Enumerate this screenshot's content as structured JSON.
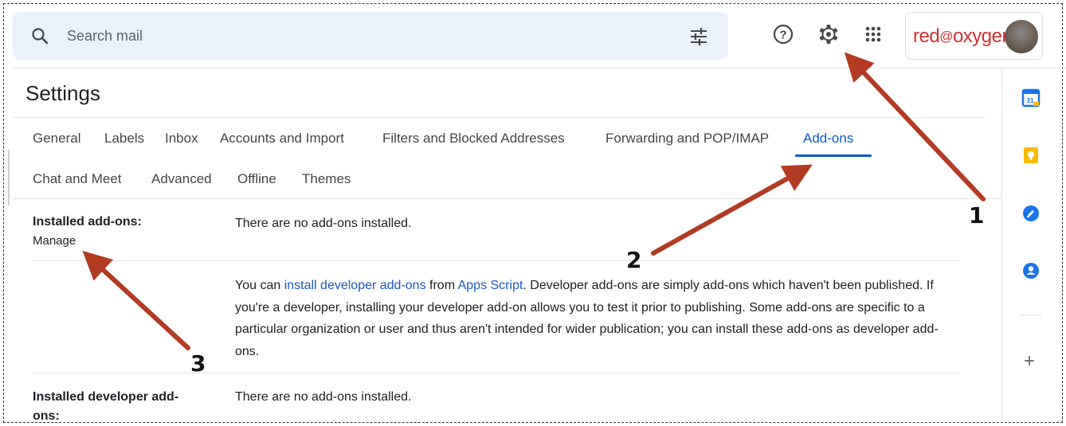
{
  "search": {
    "placeholder": "Search mail"
  },
  "header": {
    "brand_part1": "red",
    "brand_part2": "oxygen",
    "colors": {
      "brand": "#d32f2f",
      "accent": "#0b57d0",
      "link": "#1a57c6",
      "arrow": "#b23b22"
    }
  },
  "page": {
    "title": "Settings"
  },
  "tabs": [
    {
      "label": "General"
    },
    {
      "label": "Labels"
    },
    {
      "label": "Inbox"
    },
    {
      "label": "Accounts and Import"
    },
    {
      "label": "Filters and Blocked Addresses"
    },
    {
      "label": "Forwarding and POP/IMAP"
    },
    {
      "label": "Add-ons",
      "active": true
    },
    {
      "label": "Chat and Meet"
    },
    {
      "label": "Advanced"
    },
    {
      "label": "Offline"
    },
    {
      "label": "Themes"
    }
  ],
  "addons": {
    "installed_label": "Installed add-ons:",
    "manage_link": "Manage",
    "installed_value": "There are no add-ons installed.",
    "dev_p1": "You can ",
    "dev_link1": "install developer add-ons",
    "dev_p2": " from ",
    "dev_link2": "Apps Script",
    "dev_p3": ". Developer add-ons are simply add-ons which haven't been published. If you're a developer, installing your developer add-on allows you to test it prior to publishing. Some add-ons are specific to a particular organization or user and thus aren't intended for wider publication; you can install these add-ons as developer add-ons.",
    "dev_label": "Installed developer add-ons:",
    "dev_value": "There are no add-ons installed."
  },
  "sidepanel": {
    "items": [
      "calendar-icon",
      "keep-icon",
      "tasks-icon",
      "contacts-icon"
    ],
    "add_label": "+",
    "calendar_day": "31"
  },
  "annotations": {
    "one": "1",
    "two": "2",
    "three": "3"
  }
}
